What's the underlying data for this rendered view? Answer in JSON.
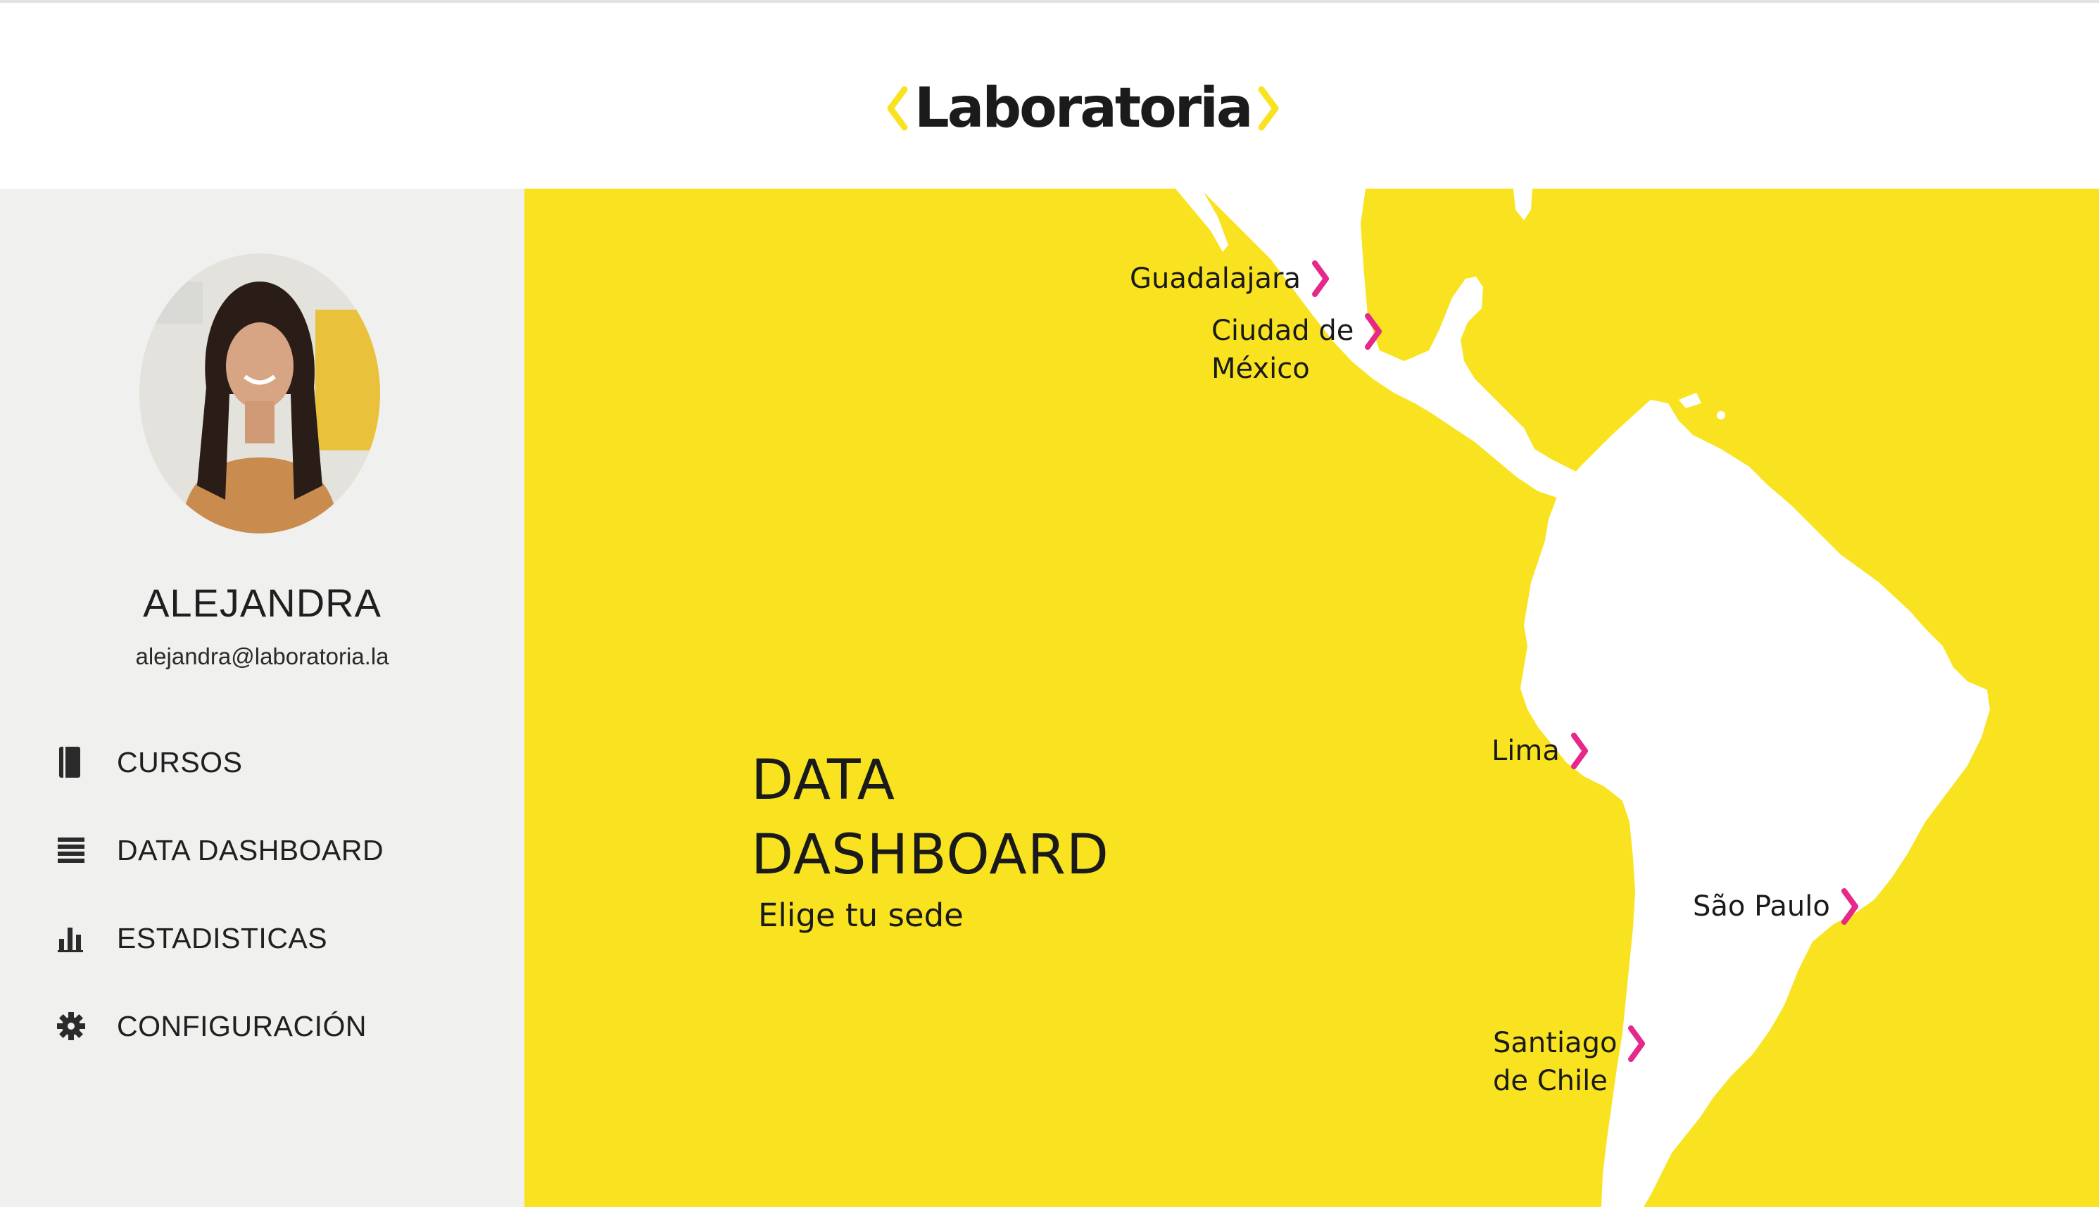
{
  "header": {
    "logo_text": "Laboratoria",
    "brand_color": "#f9e320",
    "accent_color": "#e6288a"
  },
  "sidebar": {
    "user": {
      "name": "ALEJANDRA",
      "email": "alejandra@laboratoria.la"
    },
    "nav": [
      {
        "label": "CURSOS",
        "icon": "book-icon"
      },
      {
        "label": "DATA DASHBOARD",
        "icon": "list-icon"
      },
      {
        "label": "ESTADISTICAS",
        "icon": "bar-chart-icon"
      },
      {
        "label": "CONFIGURACIÓN",
        "icon": "gear-icon"
      }
    ]
  },
  "main": {
    "title": "DATA\nDASHBOARD",
    "subtitle": "Elige tu sede",
    "cities": [
      {
        "label": "Guadalajara"
      },
      {
        "label": "Ciudad de\nMéxico"
      },
      {
        "label": "Lima"
      },
      {
        "label": "São Paulo"
      },
      {
        "label": "Santiago\nde Chile"
      }
    ]
  }
}
